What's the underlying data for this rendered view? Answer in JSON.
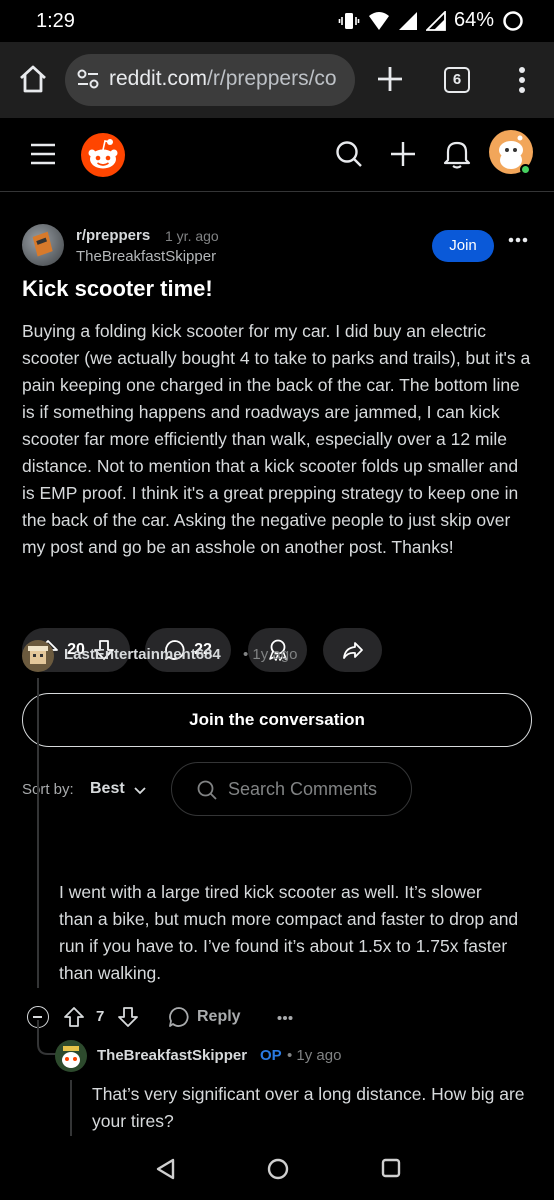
{
  "status_bar": {
    "time": "1:29",
    "battery": "64%"
  },
  "browser": {
    "url_host": "reddit.com",
    "url_path": "/r/preppers/co",
    "tab_count": "6"
  },
  "post": {
    "subreddit": "r/preppers",
    "age": "1 yr. ago",
    "author": "TheBreakfastSkipper",
    "join_label": "Join",
    "title": "Kick scooter time!",
    "body": "Buying a folding kick scooter for my car. I did buy an electric scooter (we actually bought 4 to take to parks and trails), but it's a pain keeping one charged in the back of the car. The bottom line is if something happens and roadways are jammed, I can kick scooter far more efficiently than walk, especially over a 12 mile distance. Not to mention that a kick scooter folds up smaller and is EMP proof. I think it's a great prepping strategy to keep one in the back of the car. Asking the negative people to just skip over my post and go be an asshole on another post. Thanks!",
    "score": "20",
    "comment_count": "22"
  },
  "join_conversation_label": "Join the conversation",
  "sort": {
    "label": "Sort by:",
    "value": "Best"
  },
  "comment_search": {
    "placeholder": "Search Comments"
  },
  "comments": [
    {
      "author": "LastEntertainment684",
      "age": "• 1y ago",
      "body": "I went with a large tired kick scooter as well. It’s slower than a bike, but much more compact and faster to drop and run if you have to. I’ve found it’s about 1.5x to 1.75x faster than walking.",
      "score": "7",
      "reply_label": "Reply"
    },
    {
      "author": "TheBreakfastSkipper",
      "op_tag": "OP",
      "age": "• 1y ago",
      "body": "That’s very significant over a long distance. How big are your tires?"
    }
  ],
  "colors": {
    "background": "#000000",
    "join_button": "#0a59d8",
    "reddit_orange": "#ff4500",
    "op_blue": "#2a7ae2",
    "pill_bg": "#272729"
  }
}
